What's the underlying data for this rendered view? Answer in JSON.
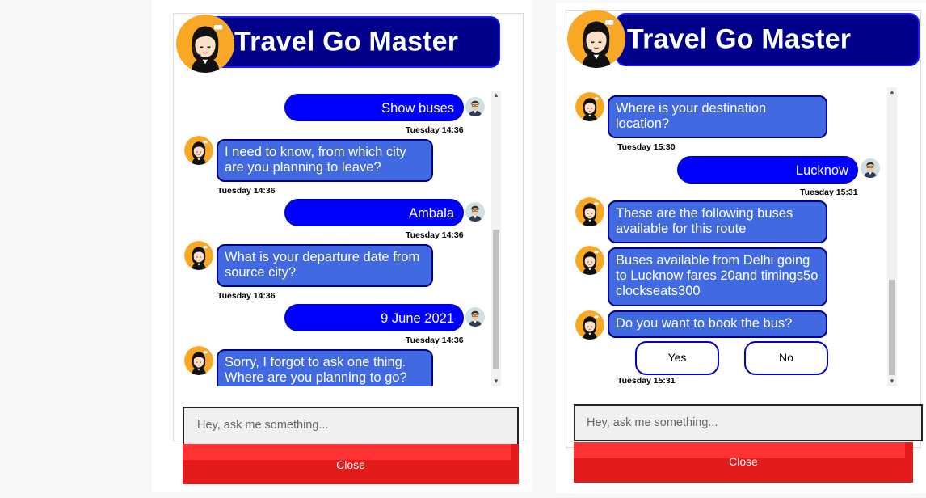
{
  "app_title": "Travel Go Master",
  "input_placeholder": "Hey, ask me something...",
  "close_label": "Close",
  "colors": {
    "header_bg": "#00008b",
    "bot_bubble": "#4169e1",
    "user_bubble": "#0000ff",
    "close_button": "#e31b1b"
  },
  "left_panel": {
    "messages": [
      {
        "sender": "user",
        "text": "Show buses",
        "time": "Tuesday 14:36"
      },
      {
        "sender": "bot",
        "text": "I need to know, from which city are you planning to leave?",
        "time": "Tuesday 14:36"
      },
      {
        "sender": "user",
        "text": "Ambala",
        "time": "Tuesday 14:36"
      },
      {
        "sender": "bot",
        "text": "What is your departure date from source city?",
        "time": "Tuesday 14:36"
      },
      {
        "sender": "user",
        "text": "9 June 2021",
        "time": "Tuesday 14:36"
      },
      {
        "sender": "bot",
        "text": "Sorry, I forgot to ask one thing. Where are you planning to go?"
      }
    ]
  },
  "right_panel": {
    "messages": [
      {
        "sender": "bot",
        "text": "Where is your destination location?",
        "time": "Tuesday 15:30"
      },
      {
        "sender": "user",
        "text": "Lucknow",
        "time": "Tuesday 15:31"
      },
      {
        "sender": "bot",
        "text": "These are the following buses available for this route"
      },
      {
        "sender": "bot",
        "text": "Buses available from Delhi going to Lucknow fares 20and timings5o clockseats300"
      },
      {
        "sender": "bot",
        "text": "Do you want to book the bus?",
        "time": "Tuesday 15:31"
      }
    ],
    "options": [
      "Yes",
      "No"
    ]
  }
}
